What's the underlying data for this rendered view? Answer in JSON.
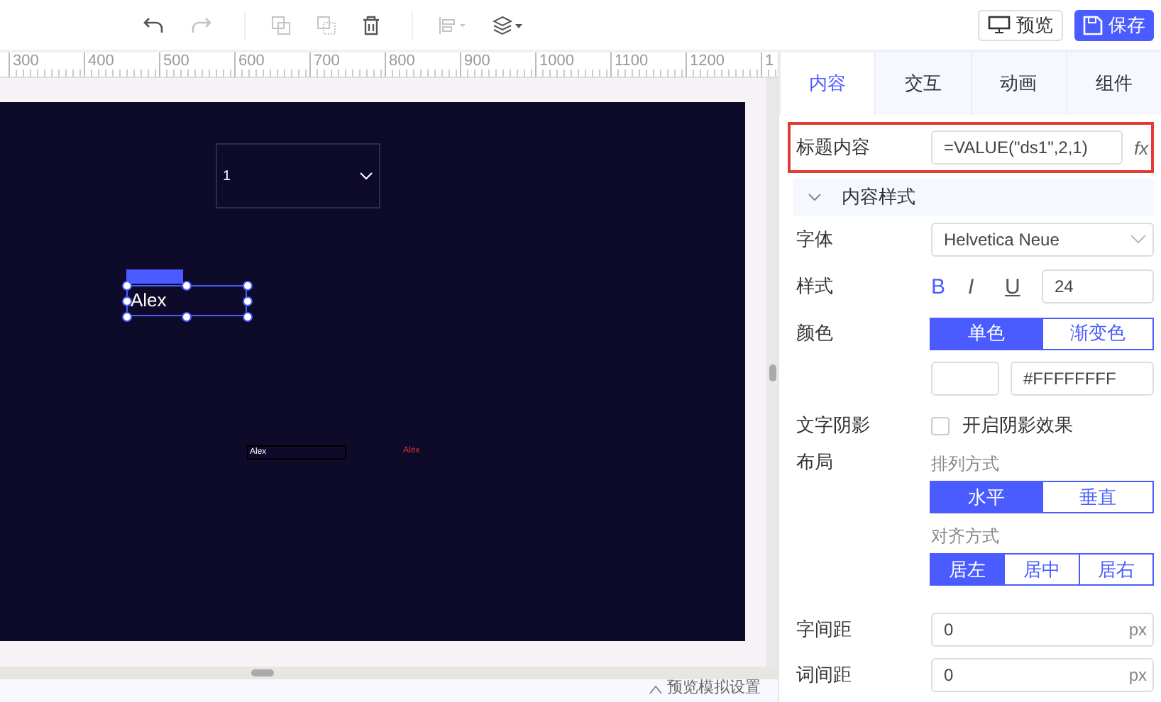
{
  "toolbar": {
    "preview_button": "预览",
    "save_button": "保存"
  },
  "ruler": {
    "ticks": [
      "300",
      "400",
      "500",
      "600",
      "700",
      "800",
      "900",
      "1000",
      "1100",
      "1200",
      "1"
    ]
  },
  "canvas": {
    "dropdown_value": "1",
    "selected_text": "Alex",
    "input_text": "Alex",
    "red_text": "Alex"
  },
  "bottom_bar": {
    "label": "预览模拟设置"
  },
  "panel": {
    "tabs": [
      {
        "label": "内容",
        "selected": true
      },
      {
        "label": "交互",
        "selected": false
      },
      {
        "label": "动画",
        "selected": false
      },
      {
        "label": "组件",
        "selected": false
      }
    ],
    "title_content": {
      "label": "标题内容",
      "value": "=VALUE(\"ds1\",2,1)",
      "fx": "fx"
    },
    "section": {
      "title": "内容样式",
      "expanded": true
    },
    "font": {
      "label": "字体",
      "value": "Helvetica Neue"
    },
    "style": {
      "label": "样式",
      "bold_label": "B",
      "italic_label": "I",
      "underline_label": "U",
      "bold": true,
      "italic": false,
      "underline": false,
      "size": "24"
    },
    "color": {
      "label": "颜色",
      "modes": [
        {
          "label": "单色",
          "selected": true
        },
        {
          "label": "渐变色",
          "selected": false
        }
      ],
      "hex": "#FFFFFFFF"
    },
    "shadow": {
      "label": "文字阴影",
      "checked": false,
      "text": "开启阴影效果"
    },
    "layout": {
      "label": "布局",
      "arrange_label": "排列方式",
      "arrange": [
        {
          "label": "水平",
          "selected": true
        },
        {
          "label": "垂直",
          "selected": false
        }
      ],
      "align_label": "对齐方式",
      "align": [
        {
          "label": "居左",
          "selected": true
        },
        {
          "label": "居中",
          "selected": false
        },
        {
          "label": "居右",
          "selected": false
        }
      ]
    },
    "letter_spacing": {
      "label": "字间距",
      "value": "0",
      "unit": "px"
    },
    "word_spacing": {
      "label": "词间距",
      "value": "0",
      "unit": "px"
    }
  }
}
